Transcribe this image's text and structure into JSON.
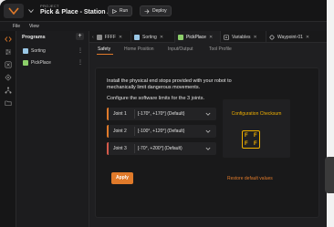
{
  "titlebar": {
    "project_label": "PROJECT",
    "project_title": "Pick & Place - Station A",
    "run_label": "Run",
    "deploy_label": "Deploy"
  },
  "menu": [
    "File",
    "View"
  ],
  "programs": {
    "header": "Programs",
    "add_label": "+",
    "items": [
      {
        "label": "Sorting",
        "color": "#9ac7e6"
      },
      {
        "label": "PickPlace",
        "color": "#8ccf6a"
      }
    ]
  },
  "tabs": [
    {
      "label": "FFFF",
      "color": "#8a8a8a"
    },
    {
      "label": "Sorting",
      "color": "#9ac7e6"
    },
    {
      "label": "PickPlace",
      "color": "#8ccf6a",
      "active": true
    },
    {
      "label": "Variables",
      "color": "#cfcfcf"
    },
    {
      "label": "Waypoint-01",
      "color": "#cfcfcf"
    }
  ],
  "subtabs": [
    {
      "label": "Safety",
      "active": true
    },
    {
      "label": "Home Position"
    },
    {
      "label": "Input/Output"
    },
    {
      "label": "Tool Profile"
    }
  ],
  "panel": {
    "instruction": "Install the physical end stops provided with your robot to mechanically limit dangerous movements.",
    "config_title": "Configure the software limits for the 3 joints.",
    "joints": [
      {
        "label": "Joint 1",
        "value": "[-170°, +170°] (Default)",
        "color": "#e07a2a"
      },
      {
        "label": "Joint 2",
        "value": "[-100°, +120°] (Default)",
        "color": "#e07a2a"
      },
      {
        "label": "Joint 3",
        "value": "[-70°, +200°] (Default)",
        "color": "#d65a4a"
      }
    ],
    "checksum": {
      "title": "Configuration Checksum",
      "cells": [
        "F",
        "F",
        "F",
        "F"
      ]
    },
    "apply_label": "Apply",
    "restore_label": "Restore default values"
  },
  "colors": {
    "accent": "#e07a2a",
    "checksum": "#f0b000"
  }
}
